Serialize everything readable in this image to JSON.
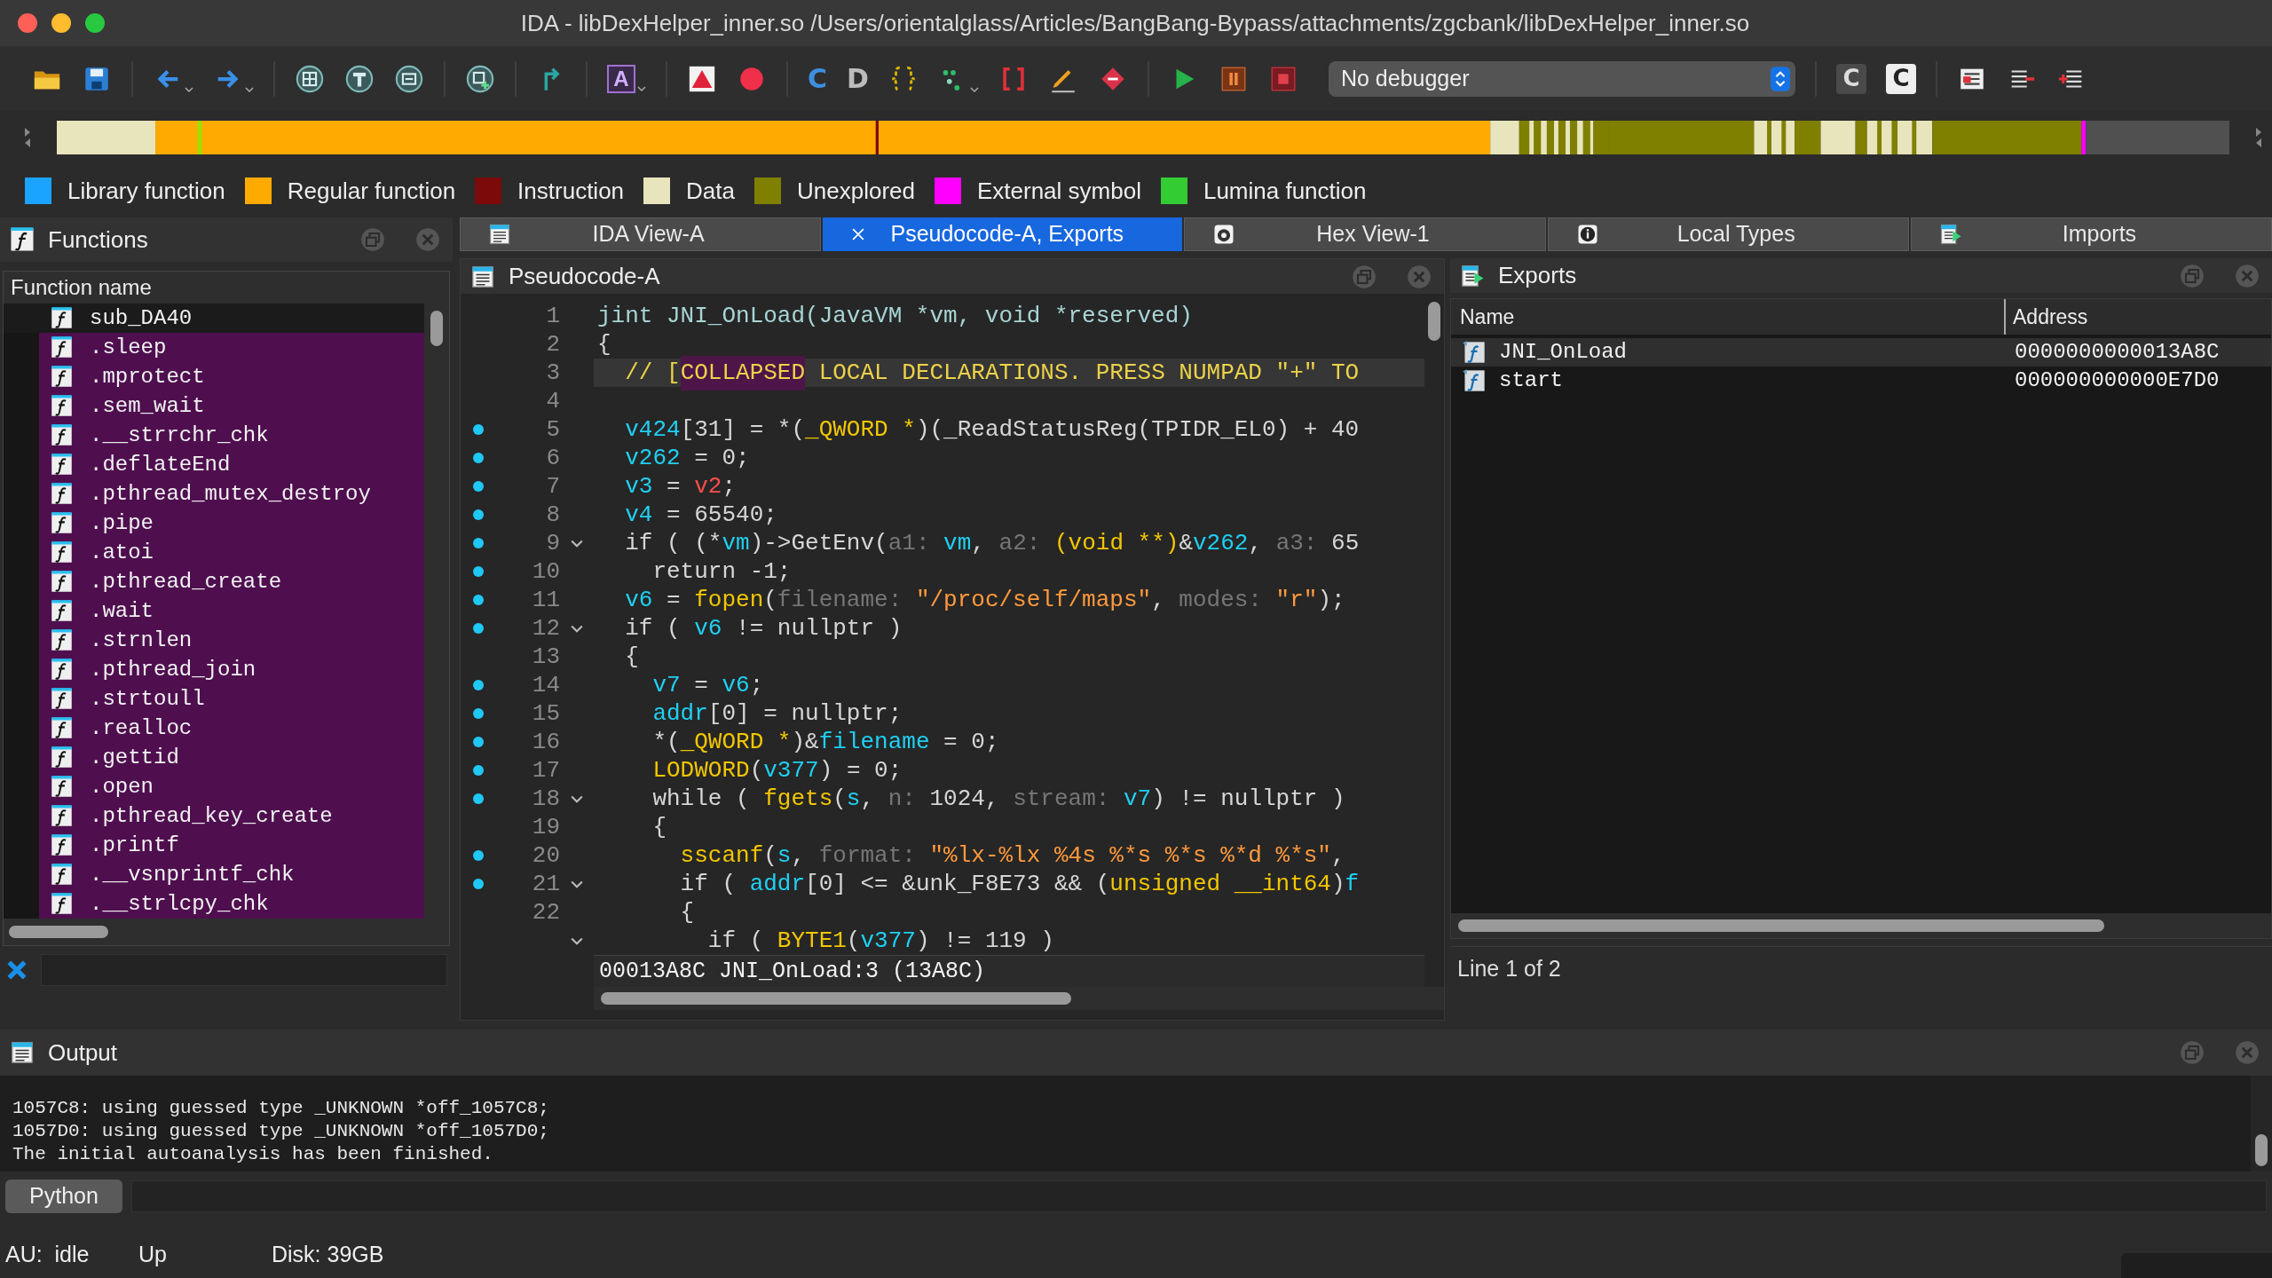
{
  "window": {
    "title": "IDA - libDexHelper_inner.so /Users/orientalglass/Articles/BangBang-Bypass/attachments/zgcbank/libDexHelper_inner.so"
  },
  "toolbar": {
    "glyphs": [
      "A",
      "C",
      "D",
      "C",
      "C"
    ],
    "debugger_select": {
      "value": "No debugger"
    }
  },
  "legend": [
    {
      "label": "Library function",
      "color": "#1aa3ff"
    },
    {
      "label": "Regular function",
      "color": "#ffaa00"
    },
    {
      "label": "Instruction",
      "color": "#7d0a0a"
    },
    {
      "label": "Data",
      "color": "#e8e4bc"
    },
    {
      "label": "Unexplored",
      "color": "#7f7f00"
    },
    {
      "label": "External symbol",
      "color": "#ff00ff"
    },
    {
      "label": "Lumina function",
      "color": "#33cc33"
    }
  ],
  "tabs": [
    {
      "label": "IDA View-A",
      "selected": false
    },
    {
      "label": "Pseudocode-A, Exports",
      "selected": true
    },
    {
      "label": "Hex View-1",
      "selected": false
    },
    {
      "label": "Local Types",
      "selected": false
    },
    {
      "label": "Imports",
      "selected": false
    }
  ],
  "functions_panel": {
    "title": "Functions",
    "column": "Function name",
    "items": [
      {
        "name": "sub_DA40",
        "kind": "regular"
      },
      {
        "name": ".sleep",
        "kind": "import"
      },
      {
        "name": ".mprotect",
        "kind": "import"
      },
      {
        "name": ".sem_wait",
        "kind": "import"
      },
      {
        "name": ".__strrchr_chk",
        "kind": "import"
      },
      {
        "name": ".deflateEnd",
        "kind": "import"
      },
      {
        "name": ".pthread_mutex_destroy",
        "kind": "import"
      },
      {
        "name": ".pipe",
        "kind": "import"
      },
      {
        "name": ".atoi",
        "kind": "import"
      },
      {
        "name": ".pthread_create",
        "kind": "import"
      },
      {
        "name": ".wait",
        "kind": "import"
      },
      {
        "name": ".strnlen",
        "kind": "import"
      },
      {
        "name": ".pthread_join",
        "kind": "import"
      },
      {
        "name": ".strtoull",
        "kind": "import"
      },
      {
        "name": ".realloc",
        "kind": "import"
      },
      {
        "name": ".gettid",
        "kind": "import"
      },
      {
        "name": ".open",
        "kind": "import"
      },
      {
        "name": ".pthread_key_create",
        "kind": "import"
      },
      {
        "name": ".printf",
        "kind": "import"
      },
      {
        "name": ".__vsnprintf_chk",
        "kind": "import"
      },
      {
        "name": ".__strlcpy_chk",
        "kind": "import"
      }
    ]
  },
  "pseudocode_panel": {
    "title": "Pseudocode-A",
    "lines": [
      {
        "number": "1",
        "dot": false,
        "foldable": false,
        "highlighted": false,
        "tokens": [
          {
            "text": "jint JNI_OnLoad(JavaVM *vm, void *reserved)",
            "kind": "declaration"
          }
        ]
      },
      {
        "number": "2",
        "dot": false,
        "foldable": false,
        "highlighted": false,
        "tokens": [
          {
            "text": "{",
            "kind": "plain"
          }
        ]
      },
      {
        "number": "3",
        "dot": false,
        "foldable": false,
        "highlighted": true,
        "tokens": [
          {
            "text": "  // [",
            "kind": "comment"
          },
          {
            "text": "COLLAPSED",
            "kind": "match"
          },
          {
            "text": " LOCAL DECLARATIONS. PRESS NUMPAD \"+\" TO",
            "kind": "comment"
          }
        ]
      },
      {
        "number": "4",
        "dot": false,
        "foldable": false,
        "highlighted": false
      },
      {
        "number": "5",
        "dot": true,
        "foldable": false,
        "highlighted": false,
        "tokens": [
          {
            "text": "  v424",
            "kind": "variable"
          },
          {
            "text": "[31] = *(",
            "kind": "plain"
          },
          {
            "text": "_QWORD *",
            "kind": "type"
          },
          {
            "text": ")(_ReadStatusReg(TPIDR_EL0) + 40",
            "kind": "plain"
          }
        ]
      },
      {
        "number": "6",
        "dot": true,
        "foldable": false,
        "highlighted": false,
        "tokens": [
          {
            "text": "  v262",
            "kind": "variable"
          },
          {
            "text": " = 0;",
            "kind": "plain"
          }
        ]
      },
      {
        "number": "7",
        "dot": true,
        "foldable": false,
        "highlighted": false,
        "tokens": [
          {
            "text": "  v3",
            "kind": "variable"
          },
          {
            "text": " = ",
            "kind": "plain"
          },
          {
            "text": "v2",
            "kind": "undefined"
          },
          {
            "text": ";",
            "kind": "plain"
          }
        ]
      },
      {
        "number": "8",
        "dot": true,
        "foldable": false,
        "highlighted": false,
        "tokens": [
          {
            "text": "  v4",
            "kind": "variable"
          },
          {
            "text": " = 65540;",
            "kind": "plain"
          }
        ]
      },
      {
        "number": "9",
        "dot": true,
        "foldable": true,
        "highlighted": false,
        "tokens": [
          {
            "text": "  if ( (*",
            "kind": "plain"
          },
          {
            "text": "vm",
            "kind": "variable"
          },
          {
            "text": ")->GetEnv(",
            "kind": "plain"
          },
          {
            "text": "a1: ",
            "kind": "hint"
          },
          {
            "text": "vm",
            "kind": "variable"
          },
          {
            "text": ", ",
            "kind": "plain"
          },
          {
            "text": "a2: ",
            "kind": "hint"
          },
          {
            "text": "(void **)",
            "kind": "type"
          },
          {
            "text": "&",
            "kind": "plain"
          },
          {
            "text": "v262",
            "kind": "variable"
          },
          {
            "text": ", ",
            "kind": "plain"
          },
          {
            "text": "a3: ",
            "kind": "hint"
          },
          {
            "text": "65",
            "kind": "plain"
          }
        ]
      },
      {
        "number": "10",
        "dot": true,
        "foldable": false,
        "highlighted": false,
        "tokens": [
          {
            "text": "    return -1;",
            "kind": "plain"
          }
        ]
      },
      {
        "number": "11",
        "dot": true,
        "foldable": false,
        "highlighted": false,
        "tokens": [
          {
            "text": "  v6",
            "kind": "variable"
          },
          {
            "text": " = ",
            "kind": "plain"
          },
          {
            "text": "fopen",
            "kind": "type"
          },
          {
            "text": "(",
            "kind": "plain"
          },
          {
            "text": "filename: ",
            "kind": "hint"
          },
          {
            "text": "\"/proc/self/maps\"",
            "kind": "string"
          },
          {
            "text": ", ",
            "kind": "plain"
          },
          {
            "text": "modes: ",
            "kind": "hint"
          },
          {
            "text": "\"r\"",
            "kind": "string"
          },
          {
            "text": ");",
            "kind": "plain"
          }
        ]
      },
      {
        "number": "12",
        "dot": true,
        "foldable": true,
        "highlighted": false,
        "tokens": [
          {
            "text": "  if ( ",
            "kind": "plain"
          },
          {
            "text": "v6",
            "kind": "variable"
          },
          {
            "text": " != nullptr )",
            "kind": "plain"
          }
        ]
      },
      {
        "number": "13",
        "dot": false,
        "foldable": false,
        "highlighted": false,
        "tokens": [
          {
            "text": "  {",
            "kind": "plain"
          }
        ]
      },
      {
        "number": "14",
        "dot": true,
        "foldable": false,
        "highlighted": false,
        "tokens": [
          {
            "text": "    v7",
            "kind": "variable"
          },
          {
            "text": " = ",
            "kind": "plain"
          },
          {
            "text": "v6",
            "kind": "variable"
          },
          {
            "text": ";",
            "kind": "plain"
          }
        ]
      },
      {
        "number": "15",
        "dot": true,
        "foldable": false,
        "highlighted": false,
        "tokens": [
          {
            "text": "    addr",
            "kind": "variable"
          },
          {
            "text": "[0] = nullptr;",
            "kind": "plain"
          }
        ]
      },
      {
        "number": "16",
        "dot": true,
        "foldable": false,
        "highlighted": false,
        "tokens": [
          {
            "text": "    *(",
            "kind": "plain"
          },
          {
            "text": "_QWORD *",
            "kind": "type"
          },
          {
            "text": ")&",
            "kind": "plain"
          },
          {
            "text": "filename",
            "kind": "variable"
          },
          {
            "text": " = 0;",
            "kind": "plain"
          }
        ]
      },
      {
        "number": "17",
        "dot": true,
        "foldable": false,
        "highlighted": false,
        "tokens": [
          {
            "text": "    LODWORD",
            "kind": "type"
          },
          {
            "text": "(",
            "kind": "plain"
          },
          {
            "text": "v377",
            "kind": "variable"
          },
          {
            "text": ") = 0;",
            "kind": "plain"
          }
        ]
      },
      {
        "number": "18",
        "dot": true,
        "foldable": true,
        "highlighted": false,
        "tokens": [
          {
            "text": "    while ( ",
            "kind": "plain"
          },
          {
            "text": "fgets",
            "kind": "type"
          },
          {
            "text": "(",
            "kind": "plain"
          },
          {
            "text": "s",
            "kind": "variable"
          },
          {
            "text": ", ",
            "kind": "plain"
          },
          {
            "text": "n: ",
            "kind": "hint"
          },
          {
            "text": "1024, ",
            "kind": "plain"
          },
          {
            "text": "stream: ",
            "kind": "hint"
          },
          {
            "text": "v7",
            "kind": "variable"
          },
          {
            "text": ") != nullptr )",
            "kind": "plain"
          }
        ]
      },
      {
        "number": "19",
        "dot": false,
        "foldable": false,
        "highlighted": false,
        "tokens": [
          {
            "text": "    {",
            "kind": "plain"
          }
        ]
      },
      {
        "number": "20",
        "dot": true,
        "foldable": false,
        "highlighted": false,
        "tokens": [
          {
            "text": "      sscanf",
            "kind": "type"
          },
          {
            "text": "(",
            "kind": "plain"
          },
          {
            "text": "s",
            "kind": "variable"
          },
          {
            "text": ", ",
            "kind": "plain"
          },
          {
            "text": "format: ",
            "kind": "hint"
          },
          {
            "text": "\"%lx-%lx %4s %*s %*s %*d %*s\"",
            "kind": "string"
          },
          {
            "text": ",",
            "kind": "plain"
          }
        ]
      },
      {
        "number": "21",
        "dot": true,
        "foldable": true,
        "highlighted": false,
        "tokens": [
          {
            "text": "      if ( ",
            "kind": "plain"
          },
          {
            "text": "addr",
            "kind": "variable"
          },
          {
            "text": "[0] <= &unk_F8E73 && (",
            "kind": "plain"
          },
          {
            "text": "unsigned __int64",
            "kind": "type"
          },
          {
            "text": ")",
            "kind": "plain"
          },
          {
            "text": "f",
            "kind": "variable"
          }
        ]
      },
      {
        "number": "22",
        "dot": false,
        "foldable": false,
        "highlighted": false,
        "tokens": [
          {
            "text": "      {",
            "kind": "plain"
          }
        ]
      },
      {
        "dot": false,
        "foldable": true,
        "highlighted": false,
        "tokens": [
          {
            "text": "        if ( ",
            "kind": "plain"
          },
          {
            "text": "BYTE1",
            "kind": "type"
          },
          {
            "text": "(",
            "kind": "plain"
          },
          {
            "text": "v377",
            "kind": "variable"
          },
          {
            "text": ") != 119 )",
            "kind": "plain"
          }
        ]
      }
    ],
    "position": "00013A8C JNI_OnLoad:3 (13A8C)"
  },
  "exports_panel": {
    "title": "Exports",
    "columns": [
      "Name",
      "Address"
    ],
    "rows": [
      {
        "name": "JNI_OnLoad",
        "address": "0000000000013A8C",
        "selected": true
      },
      {
        "name": "start",
        "address": "000000000000E7D0",
        "selected": false
      }
    ],
    "status": "Line 1 of 2"
  },
  "output_panel": {
    "title": "Output",
    "lines": [
      "1057C8: using guessed type _UNKNOWN *off_1057C8;",
      "1057D0: using guessed type _UNKNOWN *off_1057D0;",
      "The initial autoanalysis has been finished."
    ],
    "language_button": "Python"
  },
  "status_bar": {
    "items": [
      "AU:  idle",
      "Up",
      "Disk: 39GB"
    ]
  }
}
